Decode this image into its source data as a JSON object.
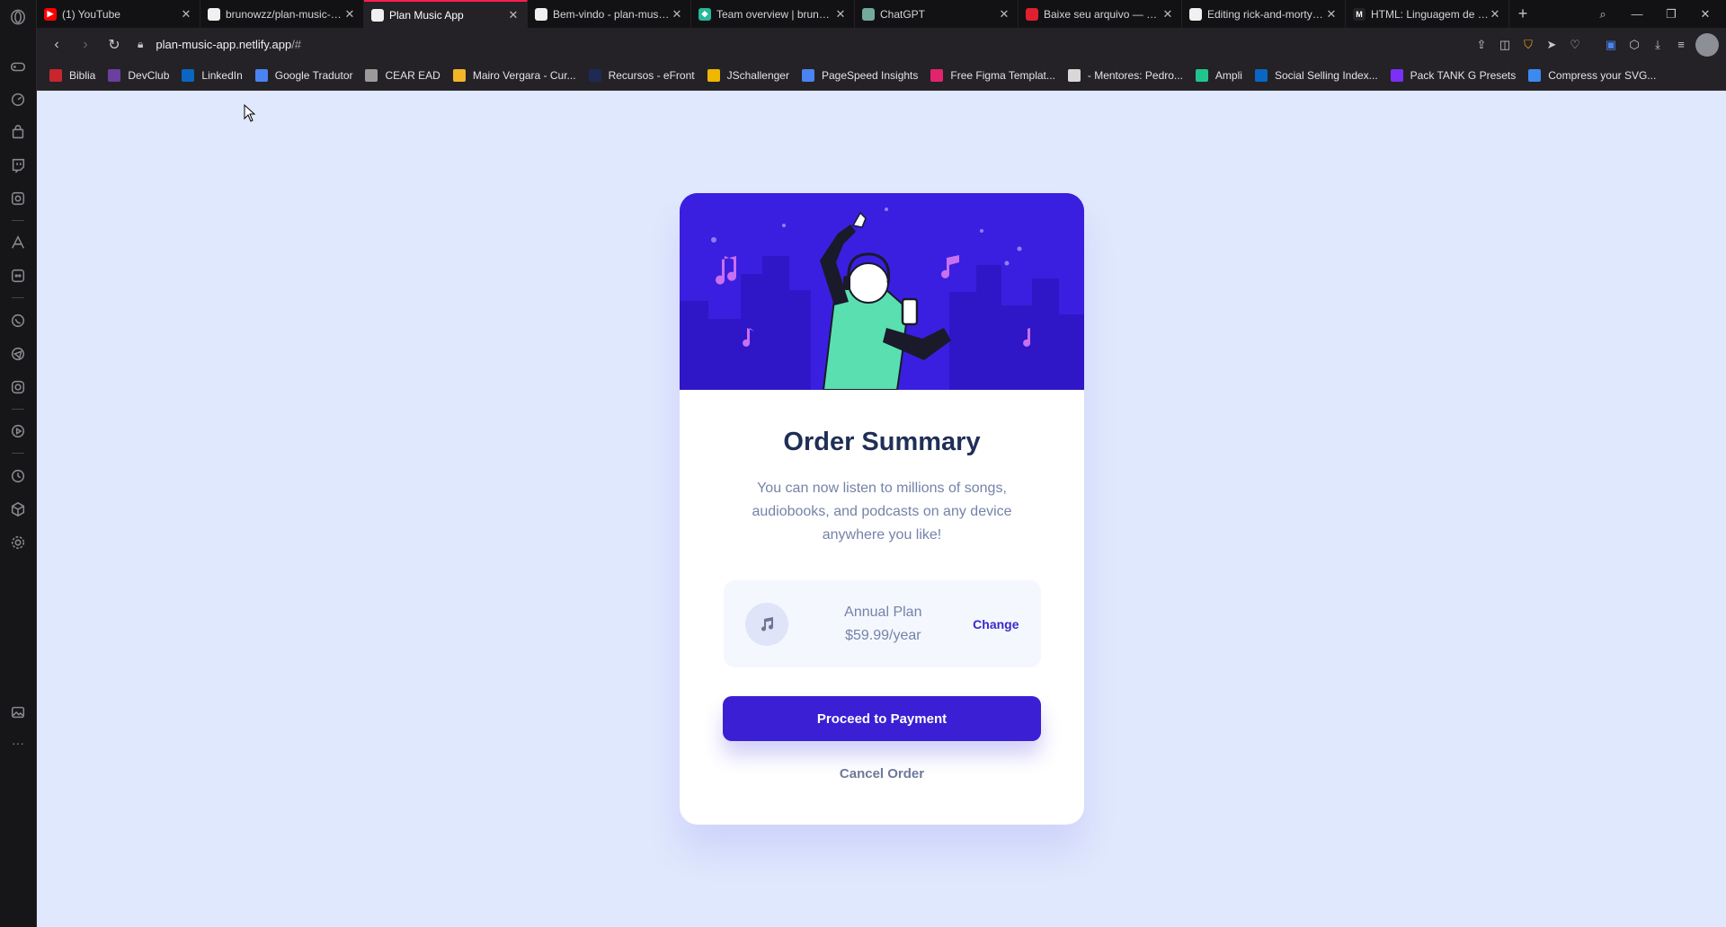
{
  "browser": {
    "tabs": [
      {
        "title": "(1) YouTube",
        "color": "#ff0000",
        "glyph": "▶"
      },
      {
        "title": "brunowzz/plan-music-app",
        "color": "#f0f0f0",
        "glyph": ""
      },
      {
        "title": "Plan Music App",
        "color": "#f0f0f0",
        "glyph": "",
        "active": true
      },
      {
        "title": "Bem-vindo - plan-music-app",
        "color": "#f0f0f0",
        "glyph": ""
      },
      {
        "title": "Team overview | brunowzz",
        "color": "#25b99a",
        "glyph": "◆"
      },
      {
        "title": "ChatGPT",
        "color": "#74aa9c",
        "glyph": ""
      },
      {
        "title": "Baixe seu arquivo — Convertio",
        "color": "#e0202e",
        "glyph": ""
      },
      {
        "title": "Editing rick-and-morty/README",
        "color": "#f0f0f0",
        "glyph": ""
      },
      {
        "title": "HTML: Linguagem de Marcação",
        "color": "#242226",
        "glyph": "M"
      }
    ],
    "new_tab": "+",
    "url_host": "plan-music-app.netlify.app",
    "url_path": "/#",
    "bookmarks": [
      {
        "label": "Biblia",
        "color": "#c8252f"
      },
      {
        "label": "DevClub",
        "color": "#6b3fa0"
      },
      {
        "label": "LinkedIn",
        "color": "#0a66c2"
      },
      {
        "label": "Google Tradutor",
        "color": "#4a84f0"
      },
      {
        "label": "CEAR EAD",
        "color": "#9a9a9a"
      },
      {
        "label": "Mairo Vergara - Cur...",
        "color": "#f2b527"
      },
      {
        "label": "Recursos - eFront",
        "color": "#1e2a55"
      },
      {
        "label": "JSchallenger",
        "color": "#f0b700"
      },
      {
        "label": "PageSpeed Insights",
        "color": "#4a84f0"
      },
      {
        "label": "Free Figma Templat...",
        "color": "#e2246e"
      },
      {
        "label": "- Mentores: Pedro...",
        "color": "#d8d8d8"
      },
      {
        "label": "Ampli",
        "color": "#22c48d"
      },
      {
        "label": "Social Selling Index...",
        "color": "#0a66c2"
      },
      {
        "label": "Pack TANK G Presets",
        "color": "#7b2ff7"
      },
      {
        "label": "Compress your SVG...",
        "color": "#3b8af0"
      }
    ]
  },
  "card": {
    "title": "Order Summary",
    "description": "You can now listen to millions of songs, audiobooks, and podcasts on any device anywhere you like!",
    "plan_name": "Annual Plan",
    "plan_price": "$59.99/year",
    "change_label": "Change",
    "pay_label": "Proceed to Payment",
    "cancel_label": "Cancel Order",
    "accent": "#3a1fd4"
  }
}
